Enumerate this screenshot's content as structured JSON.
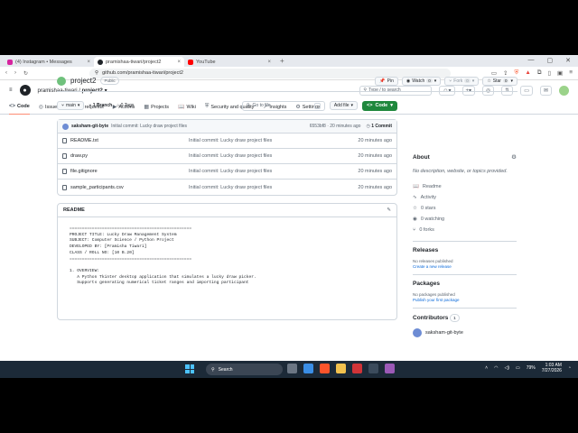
{
  "browser": {
    "tabs": [
      {
        "label": "(4) Instagram • Messages",
        "color": "#d6249f"
      },
      {
        "label": "pramishaa-tiwari/project2",
        "color": "#1f2328"
      },
      {
        "label": "YouTube",
        "color": "#ff0000"
      }
    ],
    "new_tab": "+",
    "url": "github.com/pramishaa-tiwari/project2"
  },
  "header": {
    "owner": "pramishaa-tiwari",
    "separator": "/",
    "repo": "project2",
    "search_placeholder": "Type / to search"
  },
  "repo_nav": [
    {
      "label": "Code",
      "icon": "<>"
    },
    {
      "label": "Issues",
      "icon": "◎"
    },
    {
      "label": "Pull requests",
      "icon": "⇅"
    },
    {
      "label": "Actions",
      "icon": "▶"
    },
    {
      "label": "Projects",
      "icon": "▦"
    },
    {
      "label": "Wiki",
      "icon": "📖"
    },
    {
      "label": "Security and quality",
      "icon": "⛨"
    },
    {
      "label": "Insights",
      "icon": "↗"
    },
    {
      "label": "Settings",
      "icon": "⚙"
    }
  ],
  "repo": {
    "name": "project2",
    "visibility": "Public",
    "pin": "Pin",
    "watch": "Watch",
    "watch_count": "0",
    "fork": "Fork",
    "fork_count": "0",
    "star": "Star",
    "star_count": "0"
  },
  "controls": {
    "branch": "main",
    "branches": "1 Branch",
    "tags": "0 Tags",
    "goto_placeholder": "Go to file",
    "goto_key": "t",
    "add_file": "Add file",
    "code": "Code"
  },
  "commit": {
    "author": "saksham-git-byte",
    "message": "Initial commit: Lucky draw project files",
    "hash": "6553bf8 · 20 minutes ago",
    "count": "1 Commit"
  },
  "files": [
    {
      "name": "README.txt",
      "message": "Initial commit: Lucky draw project files",
      "date": "20 minutes ago"
    },
    {
      "name": "draw.py",
      "message": "Initial commit: Lucky draw project files",
      "date": "20 minutes ago"
    },
    {
      "name": "file.gitignore",
      "message": "Initial commit: Lucky draw project files",
      "date": "20 minutes ago"
    },
    {
      "name": "sample_participants.csv",
      "message": "Initial commit: Lucky draw project files",
      "date": "20 minutes ago"
    }
  ],
  "readme": {
    "title": "README",
    "content": "=================================================\nPROJECT TITLE: Lucky Draw Management System\nSUBJECT: Computer Science / Python Project\nDEVELOPED BY: [Pramisha Tiwari]\nCLASS / ROLL NO: [10 B.20]\n=================================================\n\n1. OVERVIEW:\n   A Python Tkinter desktop application that simulates a lucky draw picker.\n   Supports generating numerical ticket ranges and importing participant"
  },
  "sidebar": {
    "about": "About",
    "description": "No description, website, or topics provided.",
    "links": [
      {
        "label": "Readme",
        "icon": "📖"
      },
      {
        "label": "Activity",
        "icon": "∿"
      },
      {
        "label": "0 stars",
        "icon": "☆"
      },
      {
        "label": "0 watching",
        "icon": "◉"
      },
      {
        "label": "0 forks",
        "icon": "⑂"
      }
    ],
    "releases": "Releases",
    "releases_none": "No releases published",
    "releases_link": "Create a new release",
    "packages": "Packages",
    "packages_none": "No packages published",
    "packages_link": "Publish your first package",
    "contributors": "Contributors",
    "contributors_count": "1",
    "contributor_name": "saksham-git-byte"
  },
  "taskbar": {
    "search": "Search",
    "battery": "79%",
    "time": "1:03 AM",
    "date": "7/27/2026"
  }
}
